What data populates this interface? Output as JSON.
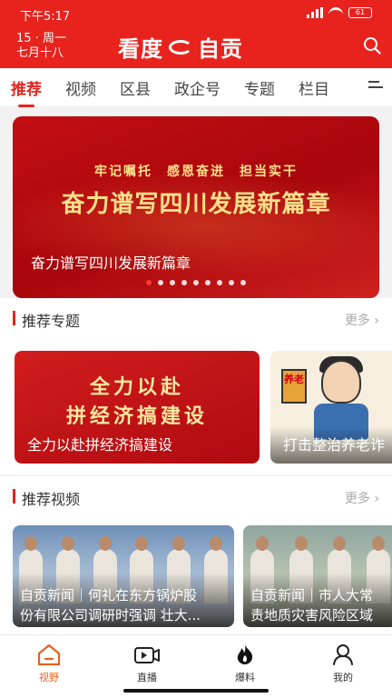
{
  "status_bar": {
    "time": "下午5:17",
    "signal": "4G",
    "battery": "61"
  },
  "header": {
    "date_line1": "15 · 周一",
    "date_line2": "七月十八",
    "logo_part1": "看度",
    "logo_part2": "自贡",
    "accent_color": "#e8231e"
  },
  "tabs": [
    {
      "label": "推荐",
      "active": true
    },
    {
      "label": "视频",
      "active": false
    },
    {
      "label": "区县",
      "active": false
    },
    {
      "label": "政企号",
      "active": false
    },
    {
      "label": "专题",
      "active": false
    },
    {
      "label": "栏目",
      "active": false
    }
  ],
  "banner": {
    "slogan": "牢记嘱托　感恩奋进　担当实干",
    "headline": "奋力谱写四川发展新篇章",
    "caption": "奋力谱写四川发展新篇章",
    "dot_count": 9,
    "active_dot": 0
  },
  "topics_section": {
    "title": "推荐专题",
    "more": "更多",
    "cards": [
      {
        "line1": "全力以赴",
        "line2": "拼经济搞建设",
        "caption": "全力以赴拼经济搞建设"
      },
      {
        "sign_text": "养老",
        "caption": "打击整治养老诈"
      }
    ]
  },
  "videos_section": {
    "title": "推荐视频",
    "more": "更多",
    "cards": [
      {
        "line1": "自贡新闻｜何礼在东方锅炉股",
        "line2": "份有限公司调研时强调 壮大..."
      },
      {
        "line1": "自贡新闻｜市人大常",
        "line2": "责地质灾害风险区域"
      }
    ]
  },
  "bottom_nav": [
    {
      "label": "视野",
      "icon": "home-icon",
      "active": true
    },
    {
      "label": "直播",
      "icon": "live-tv-icon",
      "active": false
    },
    {
      "label": "爆料",
      "icon": "fire-icon",
      "active": false
    },
    {
      "label": "我的",
      "icon": "user-icon",
      "active": false
    }
  ]
}
